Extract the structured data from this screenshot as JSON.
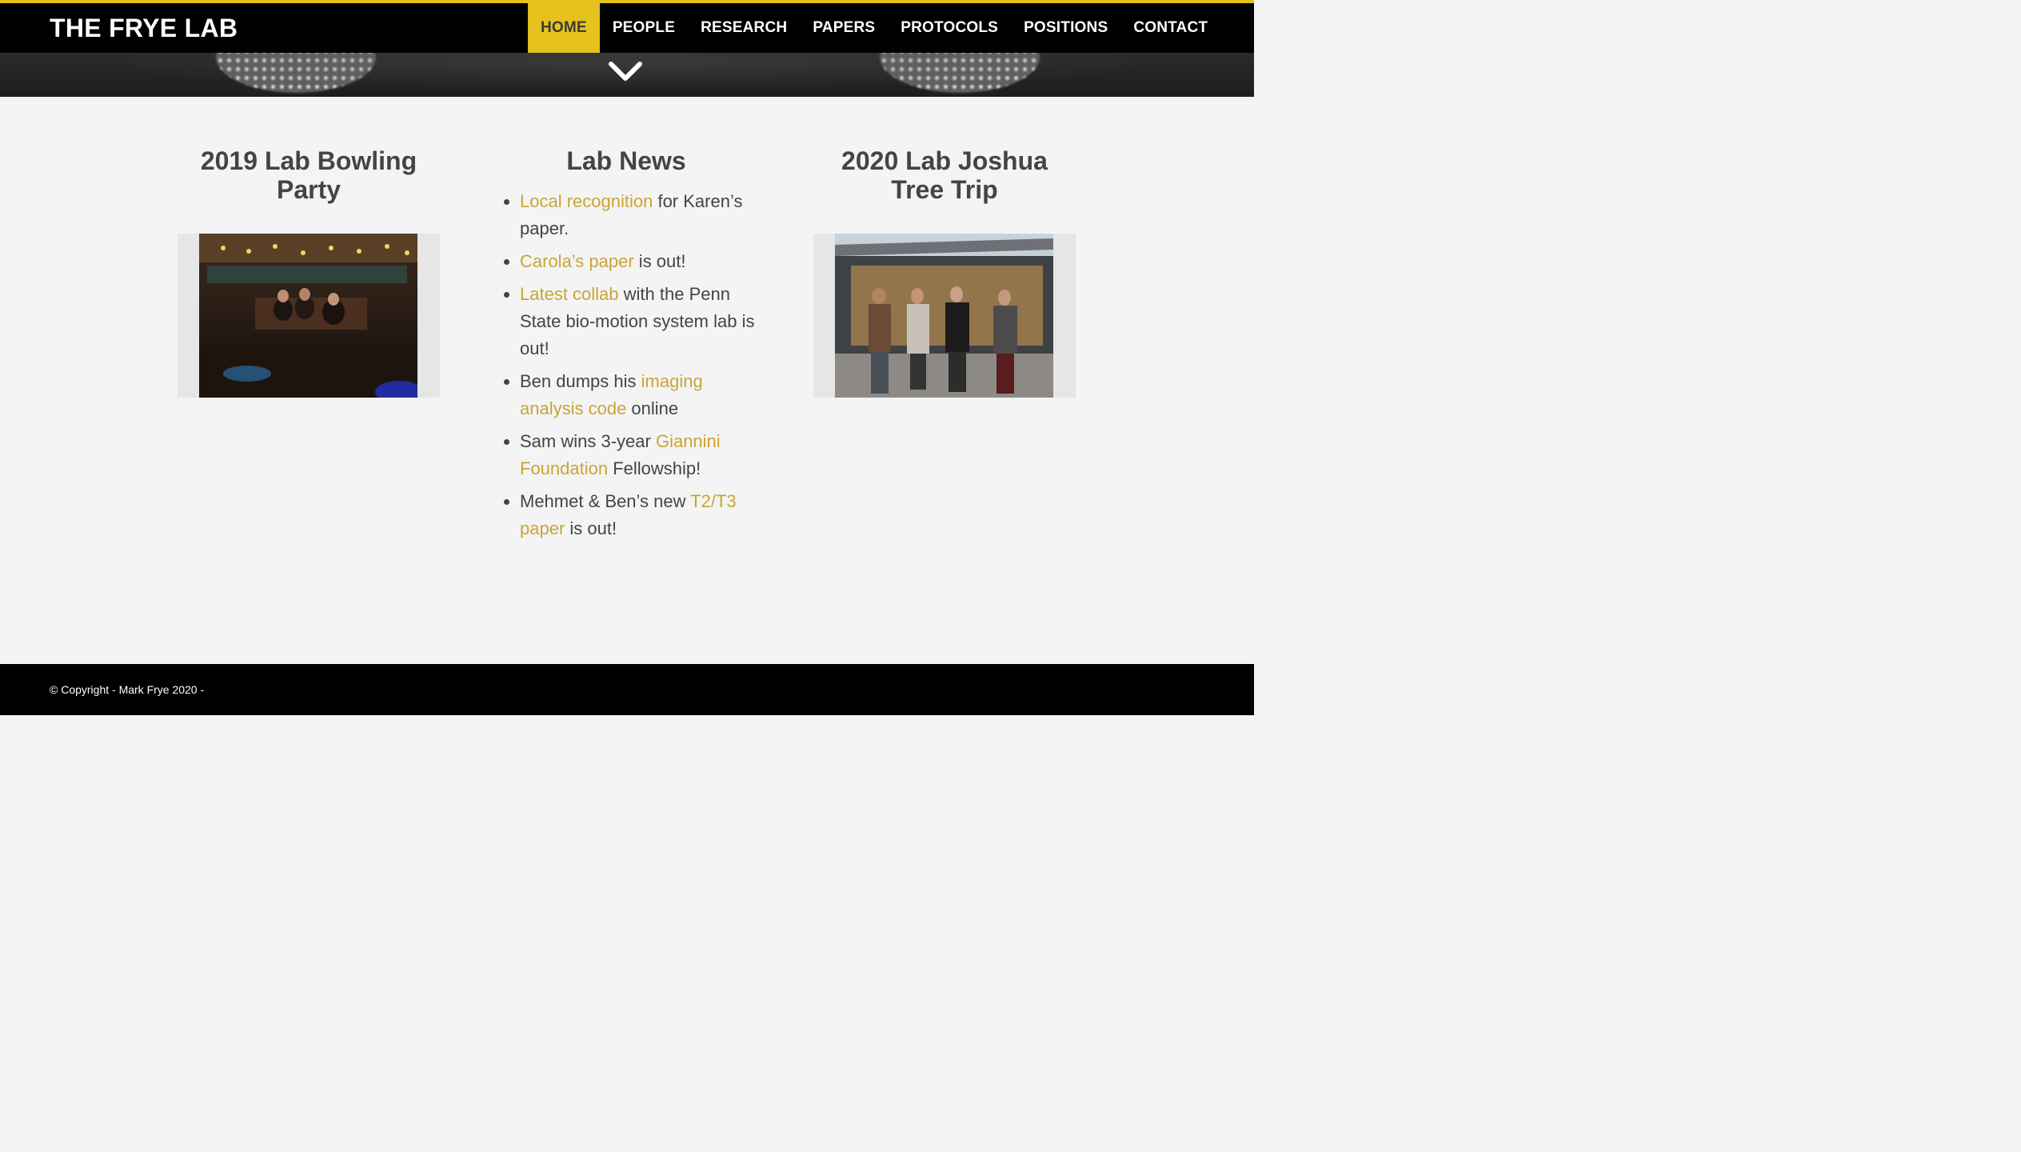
{
  "site": {
    "title": "THE FRYE LAB"
  },
  "nav": {
    "items": [
      {
        "label": "HOME",
        "active": true
      },
      {
        "label": "PEOPLE"
      },
      {
        "label": "RESEARCH"
      },
      {
        "label": "PAPERS"
      },
      {
        "label": "PROTOCOLS"
      },
      {
        "label": "POSITIONS"
      },
      {
        "label": "CONTACT"
      }
    ]
  },
  "hero": {
    "icon": "chevron-down-icon"
  },
  "left_column": {
    "title": "2019 Lab Bowling Party"
  },
  "news": {
    "title": "Lab News",
    "items": [
      {
        "link": "Local recognition",
        "text": " for Karen’s paper."
      },
      {
        "link": "Carola’s paper",
        "text": " is out!"
      },
      {
        "link": "Latest collab",
        "text": " with the Penn State bio-motion system lab is out!"
      },
      {
        "before": "Ben dumps his ",
        "link": "imaging analysis code",
        "text": " online"
      },
      {
        "before": "Sam wins 3-year ",
        "link": "Giannini Foundation",
        "text": " Fellowship!"
      },
      {
        "before": "Mehmet & Ben’s new ",
        "link": "T2/T3 paper",
        "text": " is out!"
      }
    ]
  },
  "right_column": {
    "title": "2020 Lab Joshua Tree Trip"
  },
  "footer": {
    "copyright": "© Copyright - Mark Frye 2020 -"
  },
  "colors": {
    "accent": "#e5c21c",
    "link": "#c9a536",
    "header_bg": "#000000"
  }
}
